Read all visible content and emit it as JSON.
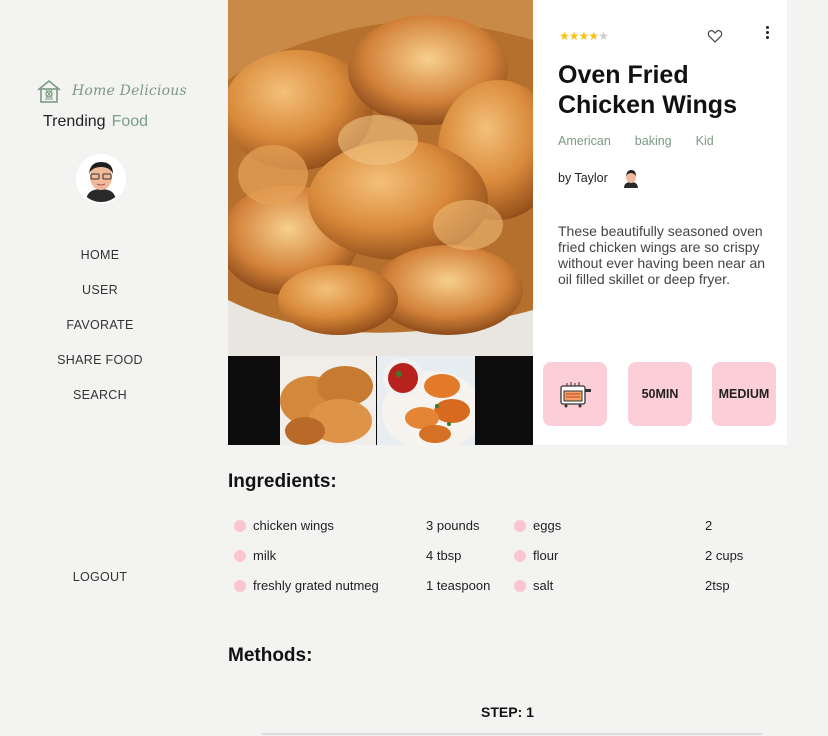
{
  "brand": {
    "name": "Home Delicious",
    "trending": "Trending",
    "food": "Food"
  },
  "nav": {
    "items": [
      "HOME",
      "USER",
      "FAVORATE",
      "SHARE FOOD",
      "SEARCH"
    ],
    "logout": "LOGOUT"
  },
  "recipe": {
    "rating": 4.5,
    "title": "Oven Fried Chicken Wings",
    "tags": [
      "American",
      "baking",
      "Kid"
    ],
    "author": "by Taylor",
    "description": "These beautifully seasoned oven fried chicken wings are so crispy without ever having been near an oil filled skillet or deep fryer.",
    "time": "50MIN",
    "difficulty": "MEDIUM",
    "equipment_icon": "oven-icon"
  },
  "ingredients": {
    "heading": "Ingredients:",
    "items": [
      {
        "name": "chicken wings",
        "qty": "3 pounds"
      },
      {
        "name": "eggs",
        "qty": "2"
      },
      {
        "name": "milk",
        "qty": "4 tbsp"
      },
      {
        "name": "flour",
        "qty": "2 cups"
      },
      {
        "name": "freshly grated nutmeg",
        "qty": "1 teaspoon"
      },
      {
        "name": "salt",
        "qty": "2tsp"
      }
    ]
  },
  "methods": {
    "heading": "Methods:",
    "step": "STEP: 1"
  },
  "colors": {
    "accent_green": "#7a9a84",
    "pink": "#fccfd8",
    "star": "#f3c316",
    "background": "#f3f4f2"
  }
}
